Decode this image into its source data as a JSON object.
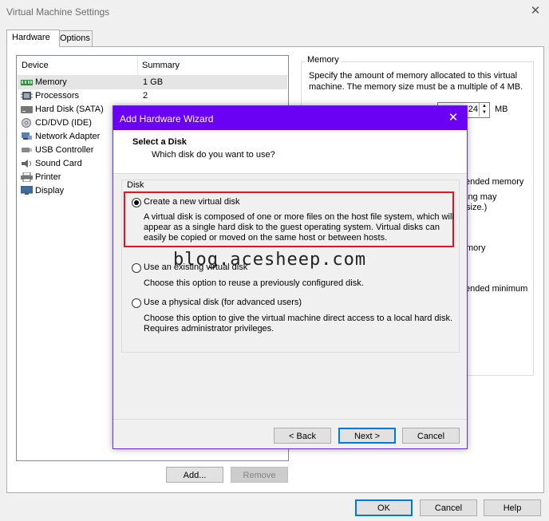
{
  "window": {
    "title": "Virtual Machine Settings"
  },
  "tabs": [
    {
      "label": "Hardware",
      "active": true
    },
    {
      "label": "Options",
      "active": false
    }
  ],
  "device_list": {
    "columns": [
      "Device",
      "Summary"
    ],
    "rows": [
      {
        "device": "Memory",
        "summary": "1 GB",
        "icon": "memory-icon",
        "selected": true
      },
      {
        "device": "Processors",
        "summary": "2",
        "icon": "processor-icon"
      },
      {
        "device": "Hard Disk (SATA)",
        "summary": "",
        "icon": "hard-disk-icon"
      },
      {
        "device": "CD/DVD (IDE)",
        "summary": "",
        "icon": "cd-dvd-icon"
      },
      {
        "device": "Network Adapter",
        "summary": "",
        "icon": "network-adapter-icon"
      },
      {
        "device": "USB Controller",
        "summary": "",
        "icon": "usb-icon"
      },
      {
        "device": "Sound Card",
        "summary": "",
        "icon": "sound-card-icon"
      },
      {
        "device": "Printer",
        "summary": "",
        "icon": "printer-icon"
      },
      {
        "device": "Display",
        "summary": "",
        "icon": "display-icon"
      }
    ],
    "add_label": "Add...",
    "remove_label": "Remove"
  },
  "memory": {
    "legend": "Memory",
    "description": "Specify the amount of memory allocated to this virtual machine. The memory size must be a multiple of 4 MB.",
    "value_fragment": "24",
    "unit": "MB",
    "fragments": [
      "ended memory",
      "ing may",
      "size.)",
      "mory",
      "ended minimum"
    ]
  },
  "footer": {
    "ok": "OK",
    "cancel": "Cancel",
    "help": "Help"
  },
  "wizard": {
    "title": "Add Hardware Wizard",
    "close_glyph": "✕",
    "header_title": "Select a Disk",
    "header_subtitle": "Which disk do you want to use?",
    "group_label": "Disk",
    "options": [
      {
        "label": "Create a new virtual disk",
        "description": "A virtual disk is composed of one or more files on the host file system, which will appear as a single hard disk to the guest operating system. Virtual disks can easily be copied or moved on the same host or between hosts.",
        "checked": true
      },
      {
        "label": "Use an existing virtual disk",
        "description": "Choose this option to reuse a previously configured disk.",
        "checked": false
      },
      {
        "label": "Use a physical disk (for advanced users)",
        "description": "Choose this option to give the virtual machine direct access to a local hard disk. Requires administrator privileges.",
        "checked": false
      }
    ],
    "back_label": "< Back",
    "next_label": "Next >",
    "cancel_label": "Cancel",
    "watermark": "blog.acesheep.com"
  },
  "colors": {
    "wizard_titlebar": "#6a00f4",
    "highlight_border": "#e81123",
    "selection": "#e5e5e5"
  }
}
